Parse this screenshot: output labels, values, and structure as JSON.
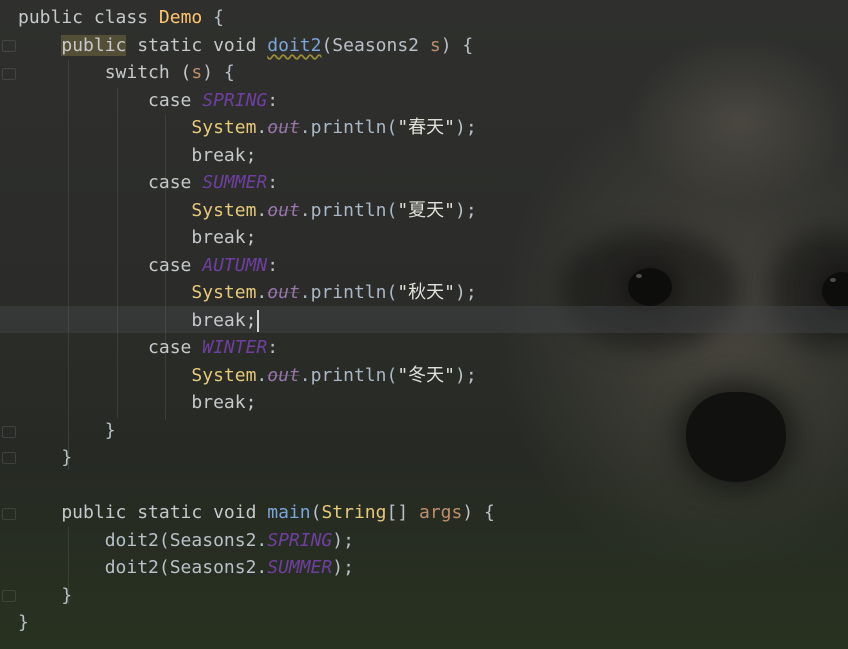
{
  "editor": {
    "lines": [
      [
        {
          "t": "public class ",
          "c": "t-kw"
        },
        {
          "t": "Demo",
          "c": "t-class"
        },
        {
          "t": " {",
          "c": "t-plain"
        }
      ],
      [
        {
          "t": "    ",
          "c": "t-plain"
        },
        {
          "t": "public",
          "c": "hl-public"
        },
        {
          "t": " static void ",
          "c": "t-kw"
        },
        {
          "t": "doit2",
          "c": "t-method wavy"
        },
        {
          "t": "(Seasons2 ",
          "c": "t-plain"
        },
        {
          "t": "s",
          "c": "t-param"
        },
        {
          "t": ") {",
          "c": "t-plain"
        }
      ],
      [
        {
          "t": "        switch (",
          "c": "t-kw"
        },
        {
          "t": "s",
          "c": "t-param"
        },
        {
          "t": ") {",
          "c": "t-plain"
        }
      ],
      [
        {
          "t": "            case ",
          "c": "t-kw"
        },
        {
          "t": "SPRING",
          "c": "t-const"
        },
        {
          "t": ":",
          "c": "t-plain"
        }
      ],
      [
        {
          "t": "                ",
          "c": "t-plain"
        },
        {
          "t": "System",
          "c": "t-sys"
        },
        {
          "t": ".",
          "c": "t-plain"
        },
        {
          "t": "out",
          "c": "t-static"
        },
        {
          "t": ".println(",
          "c": "t-println"
        },
        {
          "t": "\"春天\"",
          "c": "t-str"
        },
        {
          "t": ");",
          "c": "t-plain"
        }
      ],
      [
        {
          "t": "                break;",
          "c": "t-kw"
        }
      ],
      [
        {
          "t": "            case ",
          "c": "t-kw"
        },
        {
          "t": "SUMMER",
          "c": "t-const"
        },
        {
          "t": ":",
          "c": "t-plain"
        }
      ],
      [
        {
          "t": "                ",
          "c": "t-plain"
        },
        {
          "t": "System",
          "c": "t-sys"
        },
        {
          "t": ".",
          "c": "t-plain"
        },
        {
          "t": "out",
          "c": "t-static"
        },
        {
          "t": ".println(",
          "c": "t-println"
        },
        {
          "t": "\"夏天\"",
          "c": "t-str"
        },
        {
          "t": ");",
          "c": "t-plain"
        }
      ],
      [
        {
          "t": "                break;",
          "c": "t-kw"
        }
      ],
      [
        {
          "t": "            case ",
          "c": "t-kw"
        },
        {
          "t": "AUTUMN",
          "c": "t-const"
        },
        {
          "t": ":",
          "c": "t-plain"
        }
      ],
      [
        {
          "t": "                ",
          "c": "t-plain"
        },
        {
          "t": "System",
          "c": "t-sys"
        },
        {
          "t": ".",
          "c": "t-plain"
        },
        {
          "t": "out",
          "c": "t-static"
        },
        {
          "t": ".println(",
          "c": "t-println"
        },
        {
          "t": "\"秋天\"",
          "c": "t-str"
        },
        {
          "t": ");",
          "c": "t-plain"
        }
      ],
      [
        {
          "t": "                break;",
          "c": "t-kw",
          "cursor": true
        }
      ],
      [
        {
          "t": "            case ",
          "c": "t-kw"
        },
        {
          "t": "WINTER",
          "c": "t-const"
        },
        {
          "t": ":",
          "c": "t-plain"
        }
      ],
      [
        {
          "t": "                ",
          "c": "t-plain"
        },
        {
          "t": "System",
          "c": "t-sys"
        },
        {
          "t": ".",
          "c": "t-plain"
        },
        {
          "t": "out",
          "c": "t-static"
        },
        {
          "t": ".println(",
          "c": "t-println"
        },
        {
          "t": "\"冬天\"",
          "c": "t-str"
        },
        {
          "t": ");",
          "c": "t-plain"
        }
      ],
      [
        {
          "t": "                break;",
          "c": "t-kw"
        }
      ],
      [
        {
          "t": "        }",
          "c": "t-plain"
        }
      ],
      [
        {
          "t": "    }",
          "c": "t-plain"
        }
      ],
      [
        {
          "t": "",
          "c": "t-plain"
        }
      ],
      [
        {
          "t": "    public static void ",
          "c": "t-kw"
        },
        {
          "t": "main",
          "c": "t-method"
        },
        {
          "t": "(",
          "c": "t-plain"
        },
        {
          "t": "String",
          "c": "t-sys"
        },
        {
          "t": "[] ",
          "c": "t-plain"
        },
        {
          "t": "args",
          "c": "t-param"
        },
        {
          "t": ") {",
          "c": "t-plain"
        }
      ],
      [
        {
          "t": "        doit2(Seasons2.",
          "c": "t-plain"
        },
        {
          "t": "SPRING",
          "c": "t-const"
        },
        {
          "t": ");",
          "c": "t-plain"
        }
      ],
      [
        {
          "t": "        doit2(Seasons2.",
          "c": "t-plain"
        },
        {
          "t": "SUMMER",
          "c": "t-const"
        },
        {
          "t": ");",
          "c": "t-plain"
        }
      ],
      [
        {
          "t": "    }",
          "c": "t-plain"
        }
      ],
      [
        {
          "t": "}",
          "c": "t-plain"
        }
      ]
    ]
  },
  "background": {
    "subject": "raccoon-photo",
    "caret_line_color": "#46484c"
  }
}
